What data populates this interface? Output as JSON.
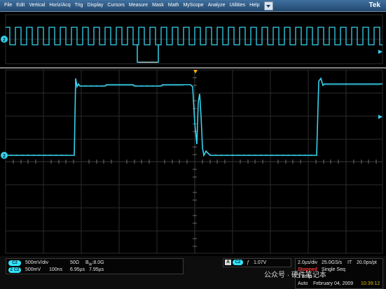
{
  "menu": {
    "items": [
      "File",
      "Edit",
      "Vertical",
      "Horiz/Acq",
      "Trig",
      "Display",
      "Cursors",
      "Measure",
      "Mask",
      "Math",
      "MyScope",
      "Analyze",
      "Utilities",
      "Help"
    ],
    "brand": "Tek"
  },
  "markers": {
    "ch2_top": "2",
    "ch2_bottom": "2"
  },
  "readouts": {
    "ch1": {
      "badge": "C2",
      "scale": "500mV/div",
      "impedance": "50Ω",
      "bw_label": "B",
      "bw_sub": "W",
      "bw_value": ":8.0G"
    },
    "ch2": {
      "badge": "Z C2",
      "scale": "500mV",
      "time": "100ns",
      "t1": "6.95µs",
      "t2": "7.95µs"
    },
    "trigger": {
      "source": "A",
      "badge": "C2",
      "slope": "ƒ",
      "level": "1.07V"
    },
    "timebase": {
      "horiz": "2.0µs/div",
      "rate": "25.0GS/s",
      "mode": "IT",
      "res": "20.0ps/pt"
    },
    "status": {
      "state": "Stopped",
      "acq": "Single Seq",
      "acqs": "1 acqs",
      "trigger_mode": "Auto",
      "date": "February 04, 2009",
      "time": "10:39:12"
    }
  },
  "watermark": "公众号 · 硬件笔记本",
  "colors": {
    "trace": "#36d2ee",
    "grid": "#2c2c2c",
    "status": "#ff3b3b",
    "clock": "#d9b800",
    "menu": "#2f5a85"
  }
}
